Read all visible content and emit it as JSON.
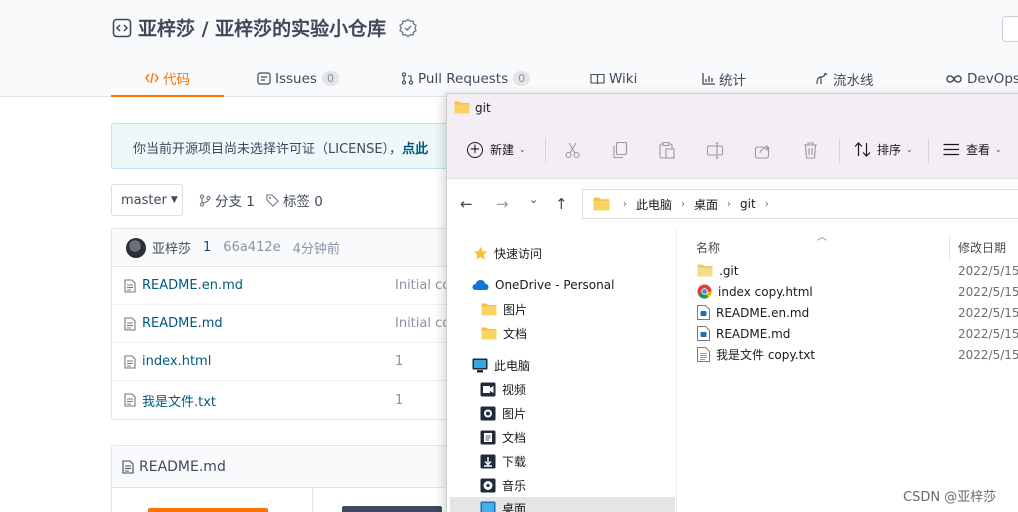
{
  "repo": {
    "title": "亚梓莎 / 亚梓莎的实验小仓库"
  },
  "tabs": [
    {
      "label": "代码",
      "icon": "code-icon",
      "count": ""
    },
    {
      "label": "Issues",
      "icon": "issues-icon",
      "count": "0"
    },
    {
      "label": "Pull Requests",
      "icon": "pull-request-icon",
      "count": "0"
    },
    {
      "label": "Wiki",
      "icon": "wiki-icon",
      "count": ""
    },
    {
      "label": "统计",
      "icon": "stats-icon",
      "count": ""
    },
    {
      "label": "流水线",
      "icon": "pipeline-icon",
      "count": ""
    },
    {
      "label": "DevOps",
      "icon": "devops-icon",
      "count": ""
    }
  ],
  "license_notice": {
    "text": "你当前开源项目尚未选择许可证（LICENSE），",
    "link": "点此"
  },
  "branch": {
    "current": "master",
    "branches_label": "分支 1",
    "tags_label": "标签 0"
  },
  "commit": {
    "author": "亚梓莎",
    "count": "1",
    "hash": "66a412e",
    "time": "4分钟前"
  },
  "files": [
    {
      "name": "README.en.md",
      "message": "Initial co"
    },
    {
      "name": "README.md",
      "message": "Initial co"
    },
    {
      "name": "index.html",
      "message": "1"
    },
    {
      "name": "我是文件.txt",
      "message": "1"
    }
  ],
  "readme": {
    "title": "README.md"
  },
  "explorer": {
    "window_title": "git",
    "toolbar": {
      "new_label": "新建",
      "sort_label": "排序",
      "view_label": "查看"
    },
    "breadcrumb": [
      "此电脑",
      "桌面",
      "git"
    ],
    "nav": {
      "quick_access": "快速访问",
      "onedrive": "OneDrive - Personal",
      "onedrive_pictures": "图片",
      "onedrive_documents": "文档",
      "this_pc": "此电脑",
      "videos": "视频",
      "pictures": "图片",
      "documents": "文档",
      "downloads": "下载",
      "music": "音乐",
      "desktop": "桌面"
    },
    "columns": {
      "name": "名称",
      "modified": "修改日期"
    },
    "items": [
      {
        "name": ".git",
        "date": "2022/5/15",
        "icon": "folder-icon"
      },
      {
        "name": "index copy.html",
        "date": "2022/5/15",
        "icon": "chrome-icon"
      },
      {
        "name": "README.en.md",
        "date": "2022/5/15",
        "icon": "md-file-icon"
      },
      {
        "name": "README.md",
        "date": "2022/5/15",
        "icon": "md-file-icon"
      },
      {
        "name": "我是文件 copy.txt",
        "date": "2022/5/15",
        "icon": "txt-file-icon"
      }
    ]
  },
  "watermark": "CSDN @亚梓莎",
  "colors": {
    "accent": "#fe7300",
    "link": "#005980",
    "text": "#40485b",
    "explorer_chrome": "#f3eef3"
  }
}
